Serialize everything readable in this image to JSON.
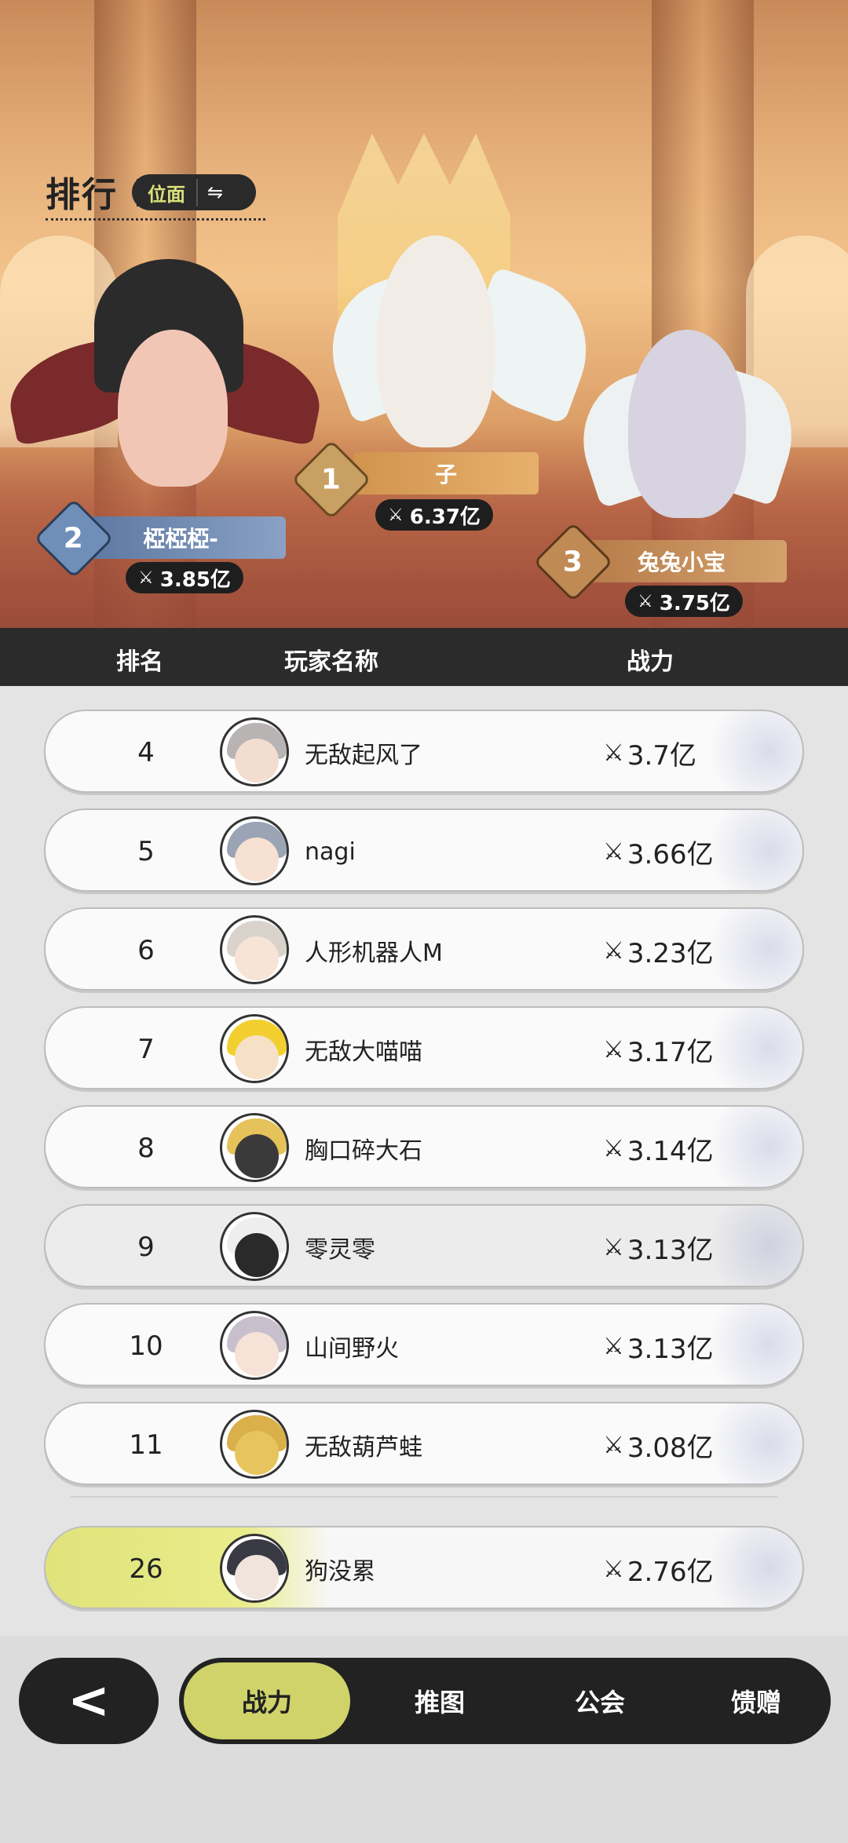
{
  "page": {
    "title": "排行",
    "switch": {
      "label": "位面",
      "icon": "swap-arrows-icon"
    }
  },
  "podium": [
    {
      "rank": "1",
      "name": "子",
      "power": "6.37亿"
    },
    {
      "rank": "2",
      "name": "椏椏椏-",
      "power": "3.85亿"
    },
    {
      "rank": "3",
      "name": "兔兔小宝",
      "power": "3.75亿"
    }
  ],
  "table_header": {
    "rank": "排名",
    "name": "玩家名称",
    "power": "战力"
  },
  "rows": [
    {
      "rank": "4",
      "name": "无敌起风了",
      "power": "3.7亿"
    },
    {
      "rank": "5",
      "name": "nagi",
      "power": "3.66亿"
    },
    {
      "rank": "6",
      "name": "人形机器人M",
      "power": "3.23亿"
    },
    {
      "rank": "7",
      "name": "无敌大喵喵",
      "power": "3.17亿"
    },
    {
      "rank": "8",
      "name": "胸口碎大石",
      "power": "3.14亿"
    },
    {
      "rank": "9",
      "name": "零灵零",
      "power": "3.13亿"
    },
    {
      "rank": "10",
      "name": "山间野火",
      "power": "3.13亿"
    },
    {
      "rank": "11",
      "name": "无敌葫芦蛙",
      "power": "3.08亿"
    }
  ],
  "self_row": {
    "rank": "26",
    "name": "狗没累",
    "power": "2.76亿"
  },
  "bottom_nav": {
    "back_icon": "chevron-left-icon",
    "tabs": [
      {
        "label": "战力",
        "active": true
      },
      {
        "label": "推图",
        "active": false
      },
      {
        "label": "公会",
        "active": false
      },
      {
        "label": "馈赠",
        "active": false
      }
    ]
  },
  "colors": {
    "accent": "#cfd36a",
    "dark": "#222222",
    "gold": "#c9a063",
    "rank2": "#6f8fb8",
    "rank3": "#c08a55"
  }
}
